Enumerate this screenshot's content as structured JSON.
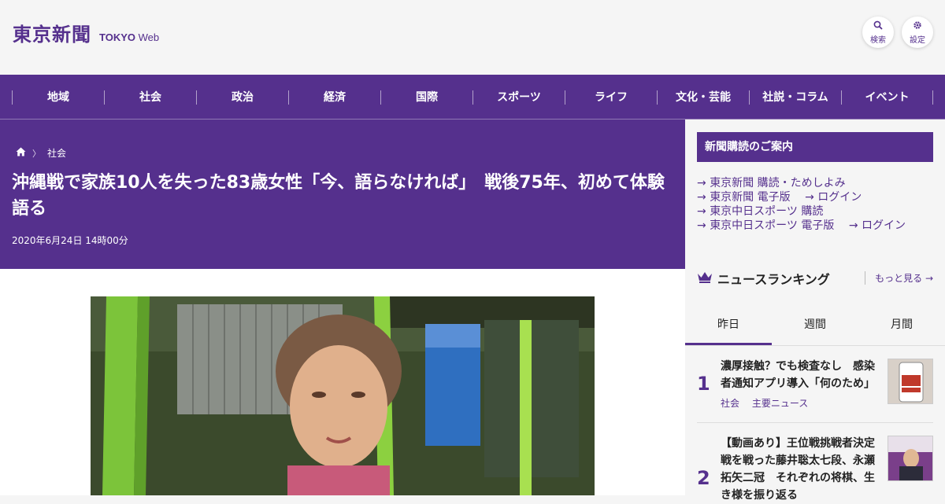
{
  "header": {
    "logo_jp": "東京新聞",
    "logo_en_bold": "TOKYO",
    "logo_en": " Web",
    "search_label": "検索",
    "settings_label": "設定"
  },
  "nav": [
    "地域",
    "社会",
    "政治",
    "経済",
    "国際",
    "スポーツ",
    "ライフ",
    "文化・芸能",
    "社説・コラム",
    "イベント"
  ],
  "breadcrumb": {
    "category": "社会",
    "separator": "〉"
  },
  "article": {
    "title": "沖縄戦で家族10人を失った83歳女性「今、語らなければ」　戦後75年、初めて体験語る",
    "date": "2020年6月24日 14時00分"
  },
  "sidebar": {
    "subscription_heading": "新聞購読のご案内",
    "links": [
      {
        "text": "東京新聞 購読・ためしよみ"
      },
      {
        "text": "東京新聞 電子版",
        "extra": "ログイン"
      },
      {
        "text": "東京中日スポーツ 購読"
      },
      {
        "text": "東京中日スポーツ 電子版",
        "extra": "ログイン"
      }
    ],
    "ranking_title": "ニュースランキング",
    "more_label": "もっと見る",
    "tabs": [
      "昨日",
      "週間",
      "月間"
    ],
    "active_tab": "昨日",
    "ranking": [
      {
        "rank": "1",
        "title": "濃厚接触？でも検査なし　感染者通知アプリ導入「何のため」",
        "tags": [
          "社会",
          "主要ニュース"
        ]
      },
      {
        "rank": "2",
        "title": "【動画あり】王位戦挑戦者決定戦を戦った藤井聡太七段、永瀬拓矢二冠　それぞれの将棋、生き様を振り返る",
        "tags": []
      }
    ]
  },
  "colors": {
    "brand": "#55308d",
    "background": "#f5f5f5"
  }
}
